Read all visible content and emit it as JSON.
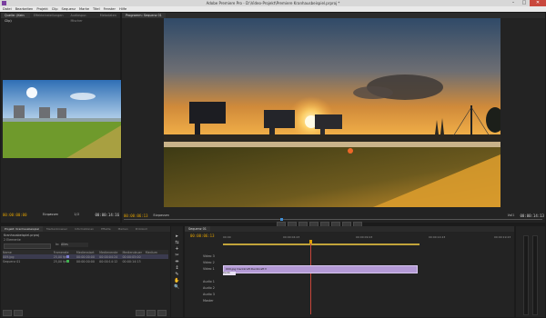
{
  "app": {
    "title": "Adobe Premiere Pro - D:\\Video-Projekt\\Premiere Kranhausbeispiel.prproj *"
  },
  "window_buttons": [
    "–",
    "□",
    "✕"
  ],
  "menu": [
    "Datei",
    "Bearbeiten",
    "Projekt",
    "Clip",
    "Sequenz",
    "Marke",
    "Titel",
    "Fenster",
    "Hilfe"
  ],
  "source_panel": {
    "tabs": [
      "Quelle: (Kein Clip)",
      "Effekteinstellungen",
      "Audiospur-Mischer",
      "Metadaten"
    ],
    "timecode_left": "00:00:00:00",
    "fit": "Einpassen",
    "ratio": "1/2",
    "timecode_right": "00:00:14:16"
  },
  "program_panel": {
    "tabs": [
      "Programm: Sequenz 01"
    ],
    "timecode_left": "00:00:06:13",
    "fit": "Einpassen",
    "ratio": "Voll",
    "timecode_right": "00:00:14:13"
  },
  "project_panel": {
    "tabs": [
      "Projekt: Kranhausbeispiel",
      "Medienbrowser",
      "Informationen",
      "Effekte",
      "Marken",
      "Protokoll"
    ],
    "project_name": "Kranhausbeispiel.prproj",
    "item_count": "2 Elemente",
    "search_label": "In:",
    "search_scope": "Alles",
    "columns": [
      "Name",
      "Framerate",
      "Medienstart",
      "Medienende",
      "Mediendauer",
      "Medium"
    ],
    "rows": [
      {
        "name": "009.jpg",
        "rate": "25,00 fps",
        "start": "00:00:00:00",
        "end": "00:00:04:24",
        "dur": "00:00:05:00",
        "color": "#7f7fcf"
      },
      {
        "name": "Sequenz 01",
        "rate": "25,00 fps",
        "start": "00:00:00:00",
        "end": "00:00:14:12",
        "dur": "00:00:14:13",
        "color": "#3fb04f"
      }
    ]
  },
  "timeline": {
    "tabs": [
      "Sequenz 01"
    ],
    "timecode": "00:00:06:13",
    "ruler": [
      "00:00",
      "00:00:04:23",
      "00:00:09:23",
      "00:00:14:23",
      "00:00:19:23"
    ],
    "tracks": [
      "Video 3",
      "Video 2",
      "Video 1",
      "Audio 1",
      "Audio 2",
      "Audio 3",
      "Master"
    ],
    "clip_label": "009.jpg  Deckkraft:Deckkraft ▾",
    "clip_label_small": "Deckk"
  },
  "tools": [
    "▸",
    "⇆",
    "+",
    "✂",
    "⇹",
    "↕",
    "✎",
    "✋",
    "🔍"
  ]
}
